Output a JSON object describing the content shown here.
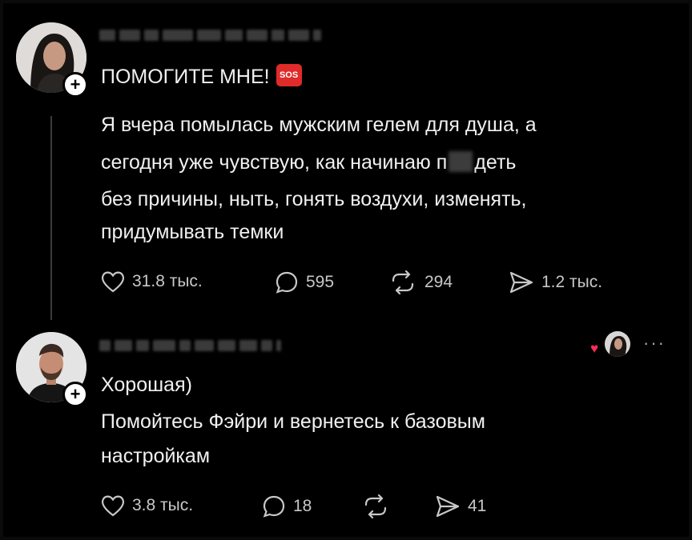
{
  "post": {
    "author_hidden": true,
    "title": "ПОМОГИТЕ МНЕ!",
    "title_badge": "SOS",
    "lines": [
      "Я вчера помылась мужским гелем для душа, а",
      "сегодня уже чувствую, как начинаю п",
      "без причины, ныть, гонять воздухи, изменять,",
      "придумывать темки"
    ],
    "line2_tail": "деть",
    "actions": {
      "likes": "31.8 тыс.",
      "comments": "595",
      "reposts": "294",
      "shares": "1.2 тыс."
    }
  },
  "reply": {
    "author_hidden": true,
    "lines": [
      "Хорошая)",
      "Помойтесь Фэйри и вернетесь к базовым",
      "настройкам"
    ],
    "more": "···",
    "actions": {
      "likes": "3.8 тыс.",
      "comments": "18",
      "reposts": "",
      "shares": "41"
    }
  },
  "colors": {
    "background": "#000000",
    "text": "#f0f0f0",
    "muted": "#c8c8c8",
    "sos": "#e02b2b",
    "heart": "#ff2d55"
  }
}
